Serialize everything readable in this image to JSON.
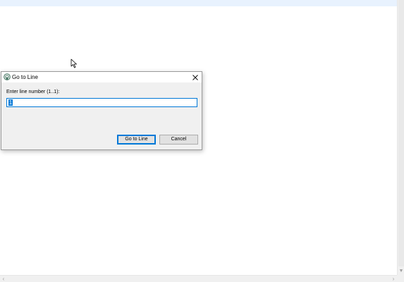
{
  "dialog": {
    "title": "Go to Line",
    "app_icon": "app-icon",
    "close_icon": "close-icon",
    "prompt_label": "Enter line number (1..1):",
    "line_input_value": "1",
    "go_button_label": "Go to Line",
    "cancel_button_label": "Cancel"
  },
  "colors": {
    "accent": "#0078d7",
    "dialog_bg": "#f0f0f0",
    "current_line_highlight": "#e8f2fe"
  },
  "scrollbars": {
    "left_arrow_icon": "chevron-left-icon",
    "right_arrow_icon": "chevron-right-icon",
    "down_arrow_icon": "chevron-down-icon"
  }
}
